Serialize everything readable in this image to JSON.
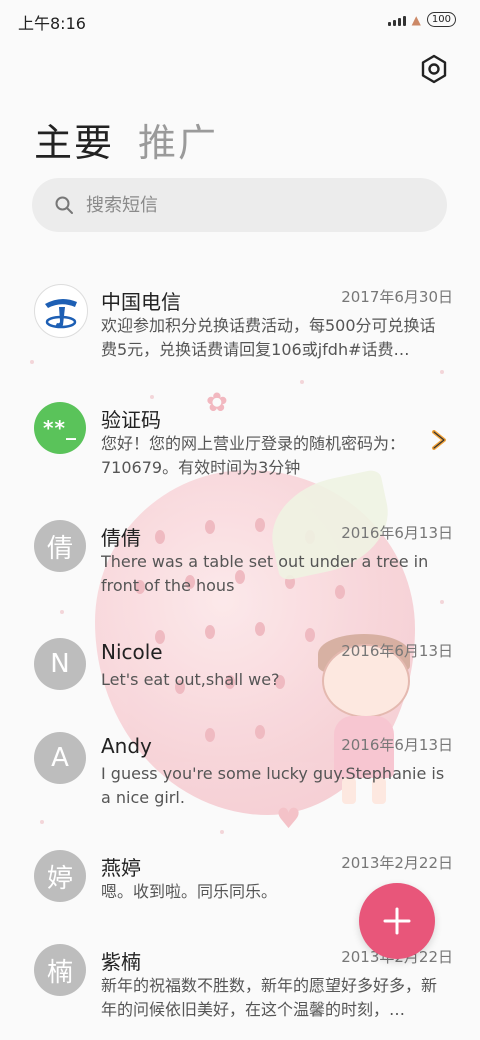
{
  "status_bar": {
    "time": "上午8:16",
    "battery": "100"
  },
  "header": {
    "tabs": [
      {
        "label": "主要",
        "active": true
      },
      {
        "label": "推广",
        "active": false
      }
    ],
    "settings_icon": "hexagon-gear-icon"
  },
  "search": {
    "placeholder": "搜索短信",
    "icon": "search-icon"
  },
  "conversations": [
    {
      "avatar_type": "telecom-logo",
      "avatar_text": "",
      "name": "中国电信",
      "date": "2017年6月30日",
      "preview": "欢迎参加积分兑换话费活动，每500分可兑换话费5元，兑换话费请回复106或jfdh#话费…"
    },
    {
      "avatar_type": "green",
      "avatar_text": "**_",
      "name": "验证码",
      "date": "",
      "preview": "您好！您的网上营业厅登录的随机密码为：710679。有效时间为3分钟"
    },
    {
      "avatar_type": "gray",
      "avatar_text": "倩",
      "name": "倩倩",
      "date": "2016年6月13日",
      "preview": "There was a table set out under a tree in front of the hous"
    },
    {
      "avatar_type": "gray",
      "avatar_text": "N",
      "name": "Nicole",
      "date": "2016年6月13日",
      "preview": "Let's eat out,shall we?"
    },
    {
      "avatar_type": "gray",
      "avatar_text": "A",
      "name": "Andy",
      "date": "2016年6月13日",
      "preview": "I guess you're some lucky guy.Stephanie is a nice girl."
    },
    {
      "avatar_type": "gray",
      "avatar_text": "婷",
      "name": "燕婷",
      "date": "2013年2月22日",
      "preview": "嗯。收到啦。同乐同乐。"
    },
    {
      "avatar_type": "gray",
      "avatar_text": "楠",
      "name": "紫楠",
      "date": "2013年2月22日",
      "preview": "新年的祝福数不胜数，新年的愿望好多好多，新年的问候依旧美好，在这个温馨的时刻，…"
    }
  ],
  "fab": {
    "icon": "plus-icon"
  },
  "colors": {
    "accent": "#e8567a",
    "avatar_gray": "#bdbdbd",
    "avatar_green": "#5ac35a"
  }
}
